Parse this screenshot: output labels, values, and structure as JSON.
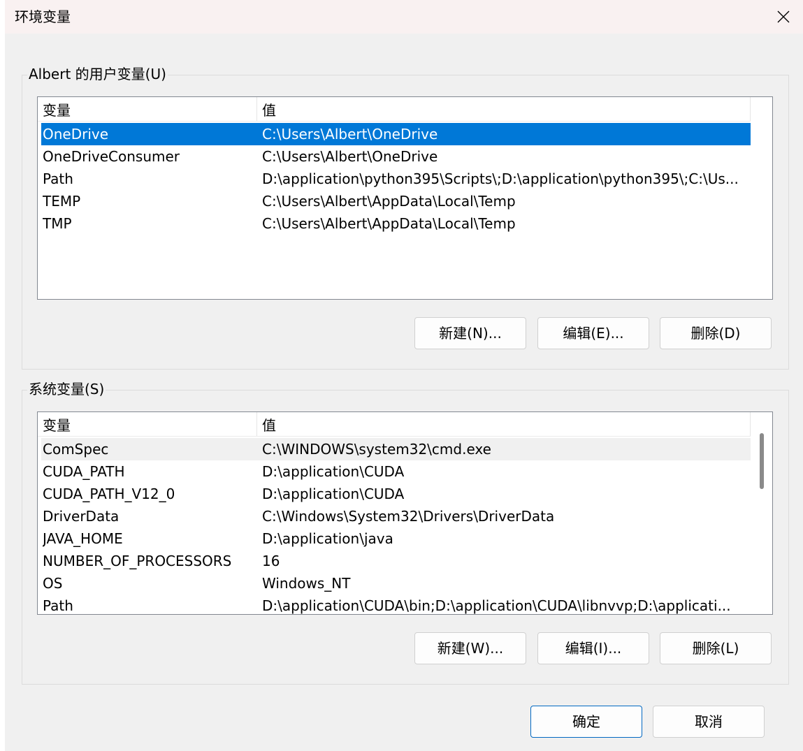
{
  "window": {
    "title": "环境变量"
  },
  "user_vars": {
    "group_label": "Albert 的用户变量(U)",
    "columns": [
      "变量",
      "值"
    ],
    "rows": [
      {
        "name": "OneDrive",
        "value": "C:\\Users\\Albert\\OneDrive"
      },
      {
        "name": "OneDriveConsumer",
        "value": "C:\\Users\\Albert\\OneDrive"
      },
      {
        "name": "Path",
        "value": "D:\\application\\python395\\Scripts\\;D:\\application\\python395\\;C:\\Us..."
      },
      {
        "name": "TEMP",
        "value": "C:\\Users\\Albert\\AppData\\Local\\Temp"
      },
      {
        "name": "TMP",
        "value": "C:\\Users\\Albert\\AppData\\Local\\Temp"
      }
    ],
    "buttons": {
      "new": "新建(N)...",
      "edit": "编辑(E)...",
      "delete": "删除(D)"
    }
  },
  "sys_vars": {
    "group_label": "系统变量(S)",
    "columns": [
      "变量",
      "值"
    ],
    "rows": [
      {
        "name": "ComSpec",
        "value": "C:\\WINDOWS\\system32\\cmd.exe"
      },
      {
        "name": "CUDA_PATH",
        "value": "D:\\application\\CUDA"
      },
      {
        "name": "CUDA_PATH_V12_0",
        "value": "D:\\application\\CUDA"
      },
      {
        "name": "DriverData",
        "value": "C:\\Windows\\System32\\Drivers\\DriverData"
      },
      {
        "name": "JAVA_HOME",
        "value": "D:\\application\\java"
      },
      {
        "name": "NUMBER_OF_PROCESSORS",
        "value": "16"
      },
      {
        "name": "OS",
        "value": "Windows_NT"
      },
      {
        "name": "Path",
        "value": "D:\\application\\CUDA\\bin;D:\\application\\CUDA\\libnvvp;D:\\applicati..."
      }
    ],
    "buttons": {
      "new": "新建(W)...",
      "edit": "编辑(I)...",
      "delete": "删除(L)"
    }
  },
  "dialog_buttons": {
    "ok": "确定",
    "cancel": "取消"
  },
  "icons": {
    "close": "close-icon"
  },
  "colors": {
    "selection": "#0078d7",
    "titlebar": "#f9f1f1",
    "primary_border": "#0067c0"
  }
}
